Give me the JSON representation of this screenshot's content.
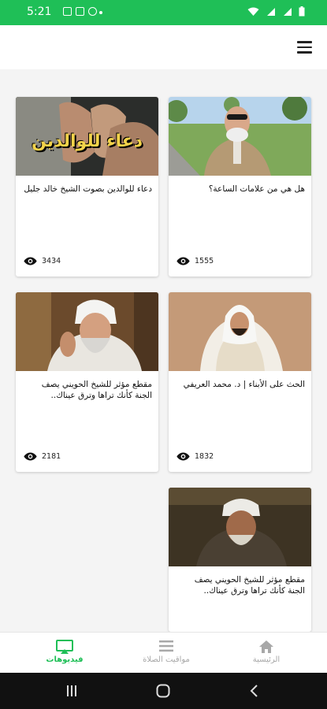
{
  "status_bar": {
    "time": "5:21"
  },
  "colors": {
    "accent": "#1fbf57",
    "inactive": "#a8a8a8"
  },
  "videos": [
    {
      "title": "هل هي من علامات الساعة؟",
      "views": "1555"
    },
    {
      "title": "دعاء للوالدين بصوت الشيخ خالد جليل",
      "views": "3434",
      "thumb_text": "دعاء للوالدين"
    },
    {
      "title": "الحث على الأبناء | د. محمد العريفي",
      "views": "1832"
    },
    {
      "title": "مقطع مؤثر للشيخ الحويني يصف الجنة كأنك تراها وترق عيناك..",
      "views": "2181"
    },
    {
      "title": "مقطع مؤثر للشيخ الحويني يصف الجنة كأنك تراها وترق عيناك..",
      "views": ""
    }
  ],
  "bottom_nav": {
    "home": "الرئيسية",
    "prayer_times": "مواقيت الصلاة",
    "videos": "فيديوهات"
  }
}
